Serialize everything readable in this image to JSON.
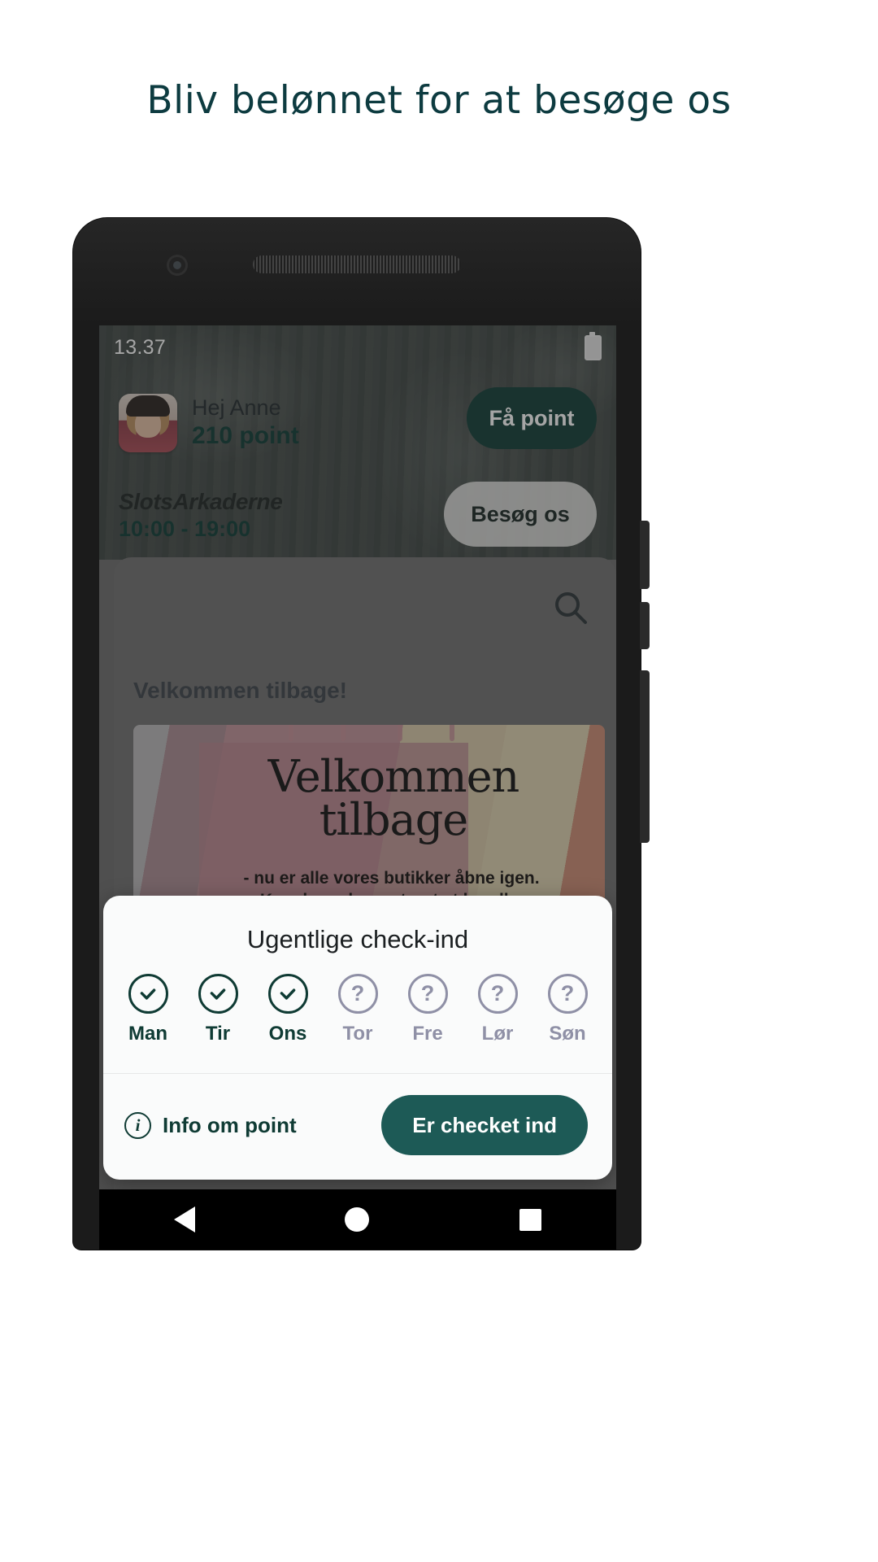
{
  "page": {
    "headline": "Bliv belønnet for at besøge os"
  },
  "phone": {
    "status_bar": {
      "time": "13.37",
      "battery_icon": "battery-icon"
    },
    "header": {
      "greeting": "Hej Anne",
      "points": "210 point",
      "get_points_button": "Få point",
      "mall_name": "SlotsArkaderne",
      "opening_hours": "10:00 - 19:00",
      "visit_button": "Besøg os",
      "avatar": "user-avatar"
    },
    "content": {
      "search_icon": "search-icon",
      "section_label": "Velkommen tilbage!",
      "banner": {
        "title_line1": "Velkommen",
        "title_line2": "tilbage",
        "subtitle_line1": "- nu er alle vores butikker åbne igen.",
        "subtitle_line2": "Kom bare, her er trygt at handle."
      }
    },
    "dialog": {
      "title": "Ugentlige check-ind",
      "days": [
        {
          "label": "Man",
          "state": "checked",
          "glyph": "check-icon"
        },
        {
          "label": "Tir",
          "state": "checked",
          "glyph": "check-icon"
        },
        {
          "label": "Ons",
          "state": "checked",
          "glyph": "check-icon"
        },
        {
          "label": "Tor",
          "state": "pending",
          "glyph": "?"
        },
        {
          "label": "Fre",
          "state": "pending",
          "glyph": "?"
        },
        {
          "label": "Lør",
          "state": "pending",
          "glyph": "?"
        },
        {
          "label": "Søn",
          "state": "pending",
          "glyph": "?"
        }
      ],
      "info_link": "Info om point",
      "info_icon": "i",
      "primary_button": "Er checket ind"
    },
    "nav_bar": {
      "back": "back-icon",
      "home": "home-icon",
      "recents": "recents-icon"
    }
  },
  "colors": {
    "brand_dark_teal": "#0f3b34",
    "brand_teal": "#1d5a56",
    "headline": "#0d3b40",
    "pending_grey": "#8f90a6"
  }
}
